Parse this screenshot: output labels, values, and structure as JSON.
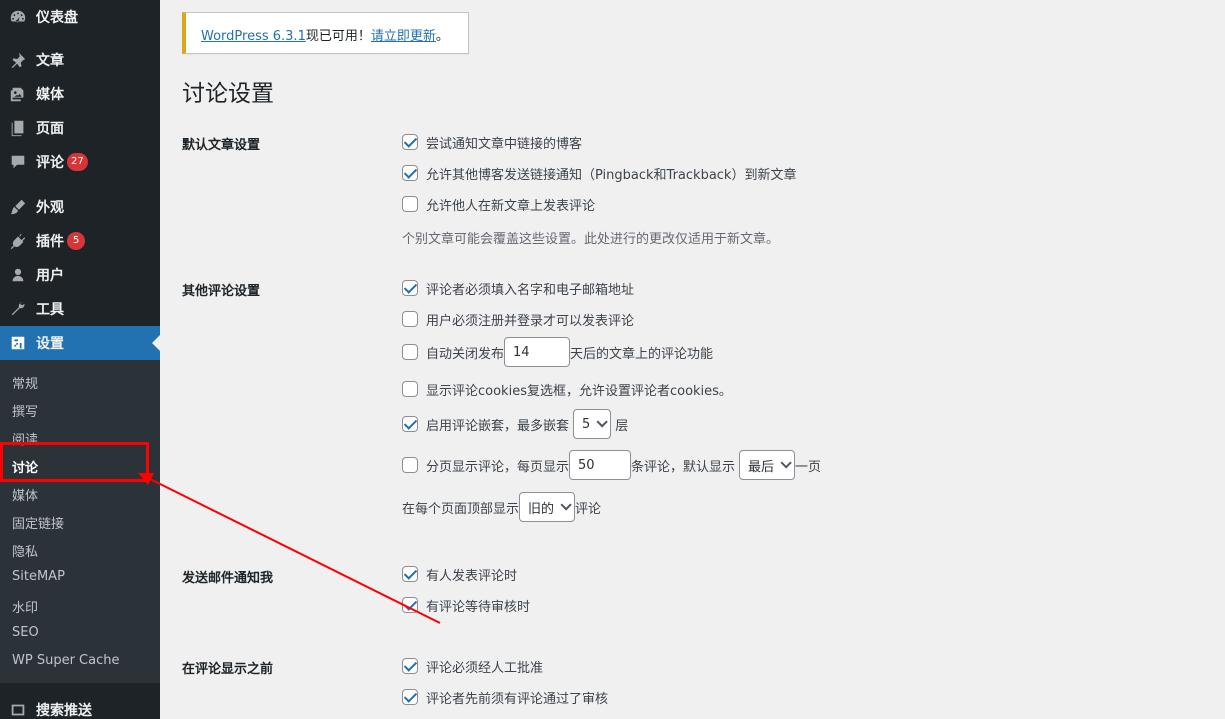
{
  "sidebar": {
    "menu": [
      {
        "label": "仪表盘",
        "icon": "dashboard-icon"
      },
      {
        "label": "文章",
        "icon": "pin-icon"
      },
      {
        "label": "媒体",
        "icon": "media-icon"
      },
      {
        "label": "页面",
        "icon": "page-icon"
      },
      {
        "label": "评论",
        "icon": "comment-icon",
        "badge": "27"
      },
      {
        "label": "外观",
        "icon": "brush-icon"
      },
      {
        "label": "插件",
        "icon": "plugin-icon",
        "badge": "5"
      },
      {
        "label": "用户",
        "icon": "user-icon"
      },
      {
        "label": "工具",
        "icon": "wrench-icon"
      },
      {
        "label": "设置",
        "icon": "settings-icon"
      },
      {
        "label": "搜索推送",
        "icon": "search-push-icon"
      }
    ],
    "submenu": [
      "常规",
      "撰写",
      "阅读",
      "讨论",
      "媒体",
      "固定链接",
      "隐私",
      "SiteMAP",
      "水印",
      "SEO",
      "WP Super Cache"
    ]
  },
  "notice": {
    "version_link": "WordPress 6.3.1",
    "text": "现已可用！",
    "update_link": "请立即更新",
    "period": "。"
  },
  "page_title": "讨论设置",
  "sections": {
    "default_article": {
      "label": "默认文章设置",
      "opt1": "尝试通知文章中链接的博客",
      "opt2": "允许其他博客发送链接通知（Pingback和Trackback）到新文章",
      "opt3": "允许他人在新文章上发表评论",
      "desc": "个别文章可能会覆盖这些设置。此处进行的更改仅适用于新文章。"
    },
    "other_comment": {
      "label": "其他评论设置",
      "opt1": "评论者必须填入名字和电子邮箱地址",
      "opt2": "用户必须注册并登录才可以发表评论",
      "opt3_pre": "自动关闭发布",
      "opt3_value": "14",
      "opt3_post": "天后的文章上的评论功能",
      "opt4": "显示评论cookies复选框，允许设置评论者cookies。",
      "opt5_pre": "启用评论嵌套，最多嵌套",
      "opt5_value": "5",
      "opt5_post": "层",
      "opt6_pre": "分页显示评论，每页显示",
      "opt6_value": "50",
      "opt6_mid": "条评论，默认显示",
      "opt6_select": "最后",
      "opt6_post": "一页",
      "opt7_pre": "在每个页面顶部显示",
      "opt7_select": "旧的",
      "opt7_post": "评论"
    },
    "email_notify": {
      "label": "发送邮件通知我",
      "opt1": "有人发表评论时",
      "opt2": "有评论等待审核时"
    },
    "before_comment": {
      "label": "在评论显示之前",
      "opt1": "评论必须经人工批准",
      "opt2": "评论者先前须有评论通过了审核"
    }
  },
  "colors": {
    "sidebar_bg": "#1d2327",
    "submenu_bg": "#2c3338",
    "accent": "#2271b1",
    "badge": "#d63638",
    "annotation": "#ff0000",
    "notice_border": "#dba617"
  }
}
